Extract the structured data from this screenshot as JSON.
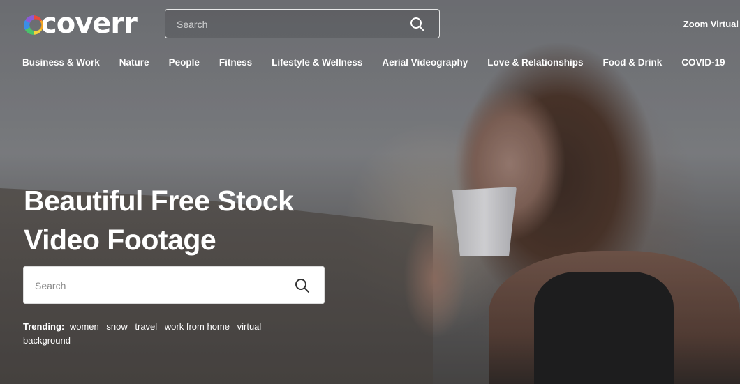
{
  "header": {
    "logo_text": "coverr",
    "search": {
      "placeholder": "Search"
    },
    "zoom_link": "Zoom Virtual"
  },
  "categories": [
    "Business & Work",
    "Nature",
    "People",
    "Fitness",
    "Lifestyle & Wellness",
    "Aerial Videography",
    "Love & Relationships",
    "Food & Drink",
    "COVID-19"
  ],
  "hero": {
    "title_line1": "Beautiful Free Stock",
    "title_line2": "Video Footage",
    "search": {
      "placeholder": "Search"
    },
    "trending": {
      "label": "Trending:",
      "tags": [
        "women",
        "snow",
        "travel",
        "work from home",
        "virtual background"
      ]
    }
  },
  "icons": {
    "search": "search-icon",
    "logo": "coverr-logo-icon"
  }
}
